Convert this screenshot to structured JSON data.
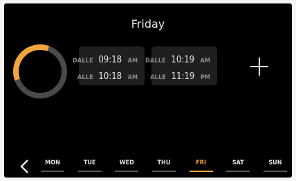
{
  "header": {
    "title": "Friday"
  },
  "ring": {
    "active_fraction": 0.36,
    "active_color": "#f2a53a",
    "inactive_color": "#4a4a4a"
  },
  "slots": [
    {
      "from_label": "DALLE",
      "from_time": "09:18",
      "from_ampm": "AM",
      "to_label": "ALLE",
      "to_time": "10:18",
      "to_ampm": "AM"
    },
    {
      "from_label": "DALLE",
      "from_time": "10:19",
      "from_ampm": "AM",
      "to_label": "ALLE",
      "to_time": "11:19",
      "to_ampm": "PM"
    }
  ],
  "add_button": {
    "icon": "plus-icon"
  },
  "nav": {
    "back_icon": "chevron-left-icon"
  },
  "days": [
    {
      "label": "MON",
      "active": false
    },
    {
      "label": "TUE",
      "active": false
    },
    {
      "label": "WED",
      "active": false
    },
    {
      "label": "THU",
      "active": false
    },
    {
      "label": "FRI",
      "active": true
    },
    {
      "label": "SAT",
      "active": false
    },
    {
      "label": "SUN",
      "active": false
    }
  ],
  "colors": {
    "accent": "#f2a53a",
    "background": "#000000",
    "card": "#1d1f21"
  }
}
